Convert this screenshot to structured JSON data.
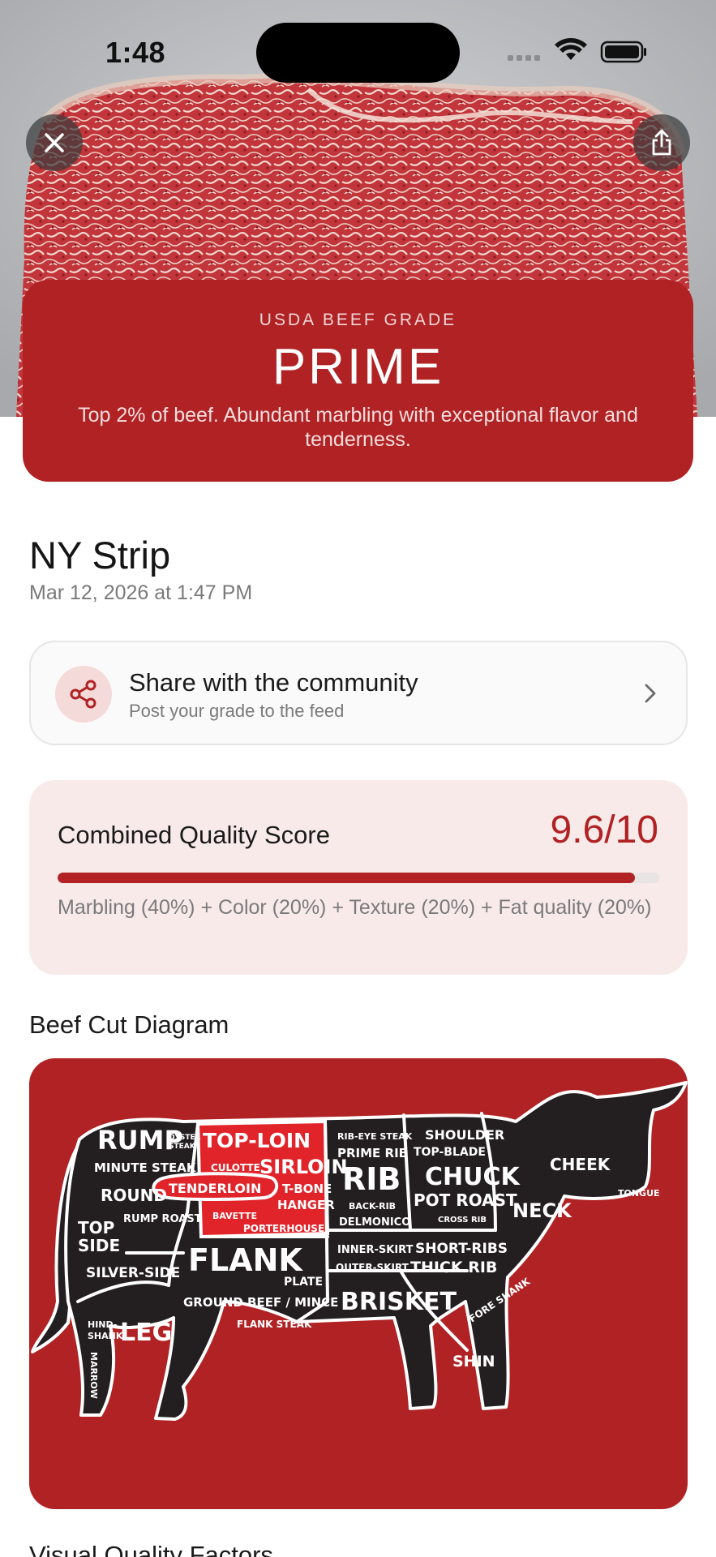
{
  "status_bar": {
    "time": "1:48"
  },
  "hero": {
    "close_icon": "close-icon",
    "share_icon": "share-upload-icon"
  },
  "grade": {
    "label": "USDA BEEF GRADE",
    "value": "PRIME",
    "description": "Top 2% of beef. Abundant marbling with exceptional flavor and tenderness."
  },
  "entry": {
    "title": "NY Strip",
    "timestamp": "Mar 12, 2026 at 1:47 PM"
  },
  "share_community": {
    "title": "Share with the community",
    "subtitle": "Post your grade to the feed",
    "icon": "share-nodes-icon"
  },
  "quality": {
    "label": "Combined Quality Score",
    "score_text": "9.6/10",
    "score": 9.6,
    "max": 10,
    "formula": "Marbling (40%) + Color (20%) + Texture (20%) + Fat quality (20%)"
  },
  "diagram": {
    "heading": "Beef Cut Diagram",
    "labels": {
      "rump": "RUMP",
      "oyster": "OYSTER",
      "steak": "STEAK",
      "minute_steak": "MINUTE STEAK",
      "round": "ROUND",
      "rump_roast": "RUMP ROAST",
      "top": "TOP",
      "side": "SIDE",
      "silver_side": "SILVER-SIDE",
      "hind": "HIND-",
      "shank": "SHANK",
      "leg": "LEG",
      "marrow": "MARROW",
      "top_loin": "TOP-LOIN",
      "culotte": "CULOTTE",
      "sirloin": "SIRLOIN",
      "tenderloin": "TENDERLOIN",
      "t_bone": "T-BONE",
      "hanger": "HANGER",
      "bavette": "BAVETTE",
      "porterhouse": "PORTERHOUSE",
      "flank": "FLANK",
      "plate": "PLATE",
      "ground_beef": "GROUND BEEF / MINCE",
      "flank_steak": "FLANK STEAK",
      "rib_eye_steak": "RIB-EYE STEAK",
      "prime_rib": "PRIME RIB",
      "rib": "RIB",
      "back_rib": "BACK-RIB",
      "delmonico": "DELMONICO",
      "shoulder": "SHOULDER",
      "top_blade": "TOP-BLADE",
      "chuck": "CHUCK",
      "pot_roast": "POT ROAST",
      "cross_rib": "CROSS RIB",
      "cheek": "CHEEK",
      "tongue": "TONGUE",
      "neck": "NECK",
      "inner_skirt": "INNER-SKIRT",
      "outer_skirt": "OUTER-SKIRT",
      "short_ribs": "SHORT-RIBS",
      "thick_rib": "THICK RIB",
      "brisket": "BRISKET",
      "fore_shank": "FORE SHANK",
      "shin": "SHIN"
    }
  },
  "next_section": {
    "heading": "Visual Quality Factors"
  },
  "colors": {
    "accent": "#b02224",
    "accent_light": "#f9eaea",
    "cow_body": "#231f20"
  }
}
